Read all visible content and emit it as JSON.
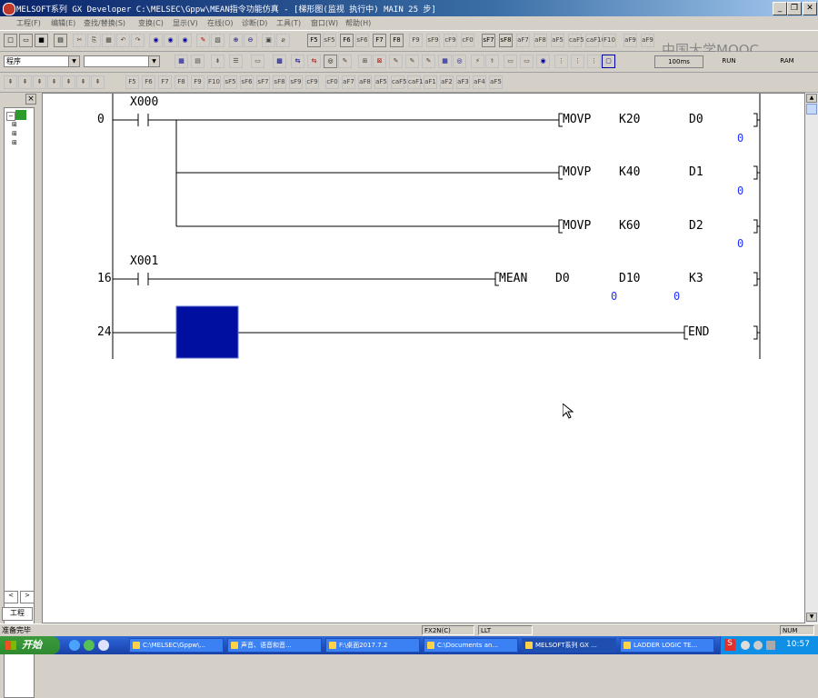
{
  "window": {
    "title": "MELSOFT系列 GX Developer C:\\MELSEC\\Gppw\\MEAN指令功能仿真 - [梯形图(监视 执行中)      MAIN      25 步]",
    "min": "_",
    "restore": "❐",
    "close": "✕"
  },
  "menu": [
    "工程(F)",
    "编辑(E)",
    "查找/替换(S)",
    "变换(C)",
    "显示(V)",
    "在线(O)",
    "诊断(D)",
    "工具(T)",
    "窗口(W)",
    "帮助(H)"
  ],
  "toolbar1": {
    "buttons": [
      "□",
      "▭",
      "💾",
      "🖶",
      "✂",
      "⎘",
      "📋",
      "↶",
      "↷",
      "🔍",
      "🔍",
      "🔍",
      "✎",
      "✎",
      "🔍",
      "🔍",
      "▤",
      "⌀",
      "F5",
      "sF5",
      "F6",
      "sF6",
      "F7",
      "F8",
      "F9",
      "sF9",
      "F10",
      "sF7",
      "sF8",
      "sF9"
    ],
    "keys": [
      "F5",
      "F6",
      "F7",
      "F8"
    ],
    "status_labels": [
      "100ms",
      "RUN",
      "RAM"
    ]
  },
  "combos": {
    "left": "程序",
    "right": ""
  },
  "tree": {
    "label": "工程"
  },
  "ladder": {
    "rungs": [
      {
        "step": "0",
        "contact": "X000",
        "instructions": [
          {
            "op": "MOVP",
            "s": "K20",
            "d": "D0",
            "val": "0"
          },
          {
            "op": "MOVP",
            "s": "K40",
            "d": "D1",
            "val": "0"
          },
          {
            "op": "MOVP",
            "s": "K60",
            "d": "D2",
            "val": "0"
          }
        ]
      },
      {
        "step": "16",
        "contact": "X001",
        "instructions": [
          {
            "op": "MEAN",
            "s": "D0",
            "d": "D10",
            "n": "K3",
            "val_s": "0",
            "val_d": "0"
          }
        ]
      },
      {
        "step": "24",
        "instructions": [
          {
            "op": "END"
          }
        ]
      }
    ]
  },
  "status": {
    "ready": "准备完毕",
    "plc": "FX2N(C)",
    "mode": "LLT",
    "num": "NUM"
  },
  "taskbar": {
    "start": "开始",
    "tasks": [
      "C:\\MELSEC\\Gppw\\...",
      "声音、语音和音...",
      "F:\\桌面2017.7.2",
      "C:\\Documents an...",
      "MELSOFT系列 GX ...",
      "LADDER LOGIC TE..."
    ],
    "clock": "10:57"
  },
  "watermark": "中国大学MOOC",
  "colors": {
    "selection": "#000fa0",
    "monitor_value": "#2030ff"
  }
}
